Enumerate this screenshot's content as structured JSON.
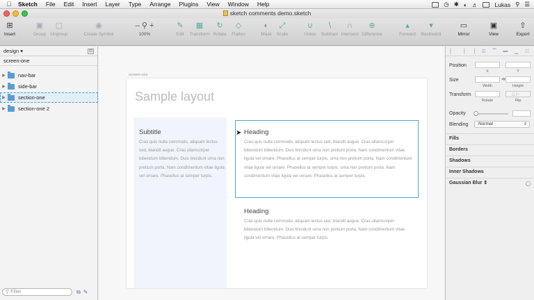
{
  "menubar": {
    "apple": "",
    "app_name": "Sketch",
    "items": [
      "File",
      "Edit",
      "Insert",
      "Layer",
      "Type",
      "Arrange",
      "Plugins",
      "View",
      "Window",
      "Help"
    ],
    "user": "Lukas"
  },
  "window": {
    "title": "sketch comments demo.sketch"
  },
  "toolbar": {
    "insert": "Insert",
    "group": "Group",
    "ungroup": "Ungroup",
    "create_symbol": "Create Symbol",
    "zoom_minus": "–",
    "zoom_level": "100%",
    "zoom_plus": "+",
    "edit": "Edit",
    "transform": "Transform",
    "rotate": "Rotate",
    "flatten": "Flatten",
    "mask": "Mask",
    "scale": "Scale",
    "union": "Union",
    "subtract": "Subtract",
    "intersect": "Intersect",
    "difference": "Difference",
    "forward": "Forward",
    "backward": "Backward",
    "mirror": "Mirror",
    "view": "View",
    "export": "Export"
  },
  "layers": {
    "page_name": "design",
    "page_chevron": "▾",
    "artboard": "screen-one",
    "items": [
      {
        "label": "nav-bar"
      },
      {
        "label": "side-bar"
      },
      {
        "label": "section-one"
      },
      {
        "label": "section-one 2"
      }
    ],
    "filter_placeholder": "Filter"
  },
  "canvas": {
    "artboard_label": "screen-one",
    "title": "Sample layout",
    "blocks": [
      {
        "heading": "Subtitle",
        "body": "Cras quis nulla commodo, aliquam lectus sed, blandit augue. Cras ullamcorper bibendum bibendum. Duis tincidunt urna non pretium porta. Nam condimentum vitae ligula vel ornare. Phasellus at semper turpis."
      },
      {
        "heading": "Heading",
        "body": "Cras quis nulla commodo, aliquam lectus sed, blandit augue. Cras ullamcorper bibendum bibendum. Duis tincidunt urna non pretium porta. Nam condimentum vitae ligula vel ornare. Phasellus at semper turpis. urna non pretium porta. Nam condimentum vitae ligula vel ornare. Phasellus at semper turpis. urna non pretium porta. Nam condimentum vitae ligula vel ornare. Phasellus at semper turpis."
      },
      {
        "heading": "Heading",
        "body": "Cras quis nulla commodo, aliquam lectus sed, blandit augue. Cras ullamcorper bibendum bibendum. Duis tincidunt urna non pretium porta. Nam condimentum vitae ligula vel ornare. Phasellus at semper turpis."
      }
    ]
  },
  "inspector": {
    "position": "Position",
    "x": "X",
    "y": "Y",
    "size": "Size",
    "width": "Width",
    "height": "Height",
    "transform": "Transform",
    "rotate": "Rotate",
    "flip": "Flip",
    "opacity": "Opacity",
    "blending": "Blending",
    "blending_value": "Normal",
    "fills": "Fills",
    "borders": "Borders",
    "shadows": "Shadows",
    "inner_shadows": "Inner Shadows",
    "gaussian_blur": "Gaussian Blur ⇕"
  },
  "colors": {
    "selection": "#4aa3d8",
    "folder": "#5b9bd5",
    "close": "#fc5f57",
    "minimize": "#fdbc2e",
    "zoom": "#33c748"
  }
}
